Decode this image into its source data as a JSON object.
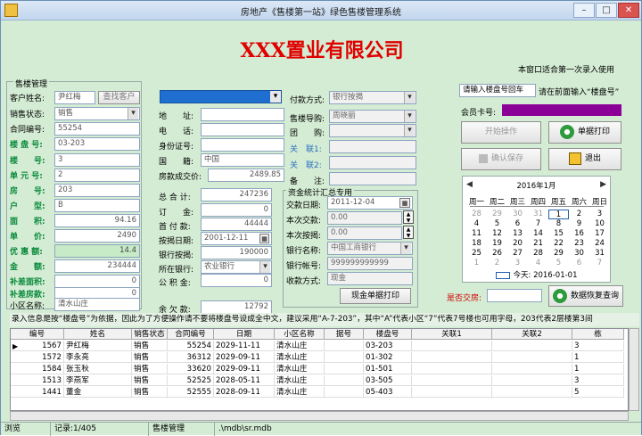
{
  "window": {
    "title": "房地产《售楼第一站》绿色售楼管理系统"
  },
  "header": {
    "company": "XXX置业有限公司",
    "note": "本窗口适合第一次录入使用"
  },
  "group": {
    "label": "售楼管理"
  },
  "left": {
    "cust_name_label": "客户姓名:",
    "cust_name": "尹红梅",
    "find_customer": "查找客户",
    "status_label": "销售状态:",
    "status": "销售",
    "contract_label": "合同编号:",
    "contract": "55254",
    "building_label": "楼 盘 号:",
    "building": "03-203",
    "tower_label": "楼　　号:",
    "tower": "3",
    "unit_label": "单 元 号:",
    "unit": "2",
    "room_label": "房　　号:",
    "room": "203",
    "type_label": "户　　型:",
    "type": "B",
    "area_label": "面　　积:",
    "area": "94.16",
    "price_label": "单　　价:",
    "price": "2490",
    "discount_label": "优 惠 额:",
    "discount": "14.4",
    "amount_label": "金　　额:",
    "amount": "234444",
    "extra_area_label": "补差面积:",
    "extra_area": "0",
    "extra_money_label": "补差房款:",
    "extra_money": "0",
    "estate_label": "小区名称:",
    "estate": "清水山庄"
  },
  "mid": {
    "address_label": "地　　址:",
    "phone_label": "电　　话:",
    "id_label": "身份证号:",
    "nation_label": "国　　籍:",
    "nation": "中国",
    "deal_price_label": "房款成交价:",
    "deal_price": "2489.85",
    "total_label": "总 合 计:",
    "total": "247236",
    "deposit_label": "订　　金:",
    "deposit": "0",
    "down_label": "首 付 款:",
    "down": "44444",
    "loan_date_label": "按揭日期:",
    "loan_date": "2001-12-11",
    "bank_loan_label": "银行按揭:",
    "bank_loan": "190000",
    "bank_label": "所在银行:",
    "bank": "农业银行",
    "fund_label": "公 积 金:",
    "fund": "0",
    "balance_label": "余 欠 款:",
    "balance": "12792"
  },
  "right": {
    "paymode_label": "付款方式:",
    "paymode": "银行按揭",
    "guide_label": "售楼导购:",
    "guide": "周晓丽",
    "group_buy_label": "团　　购:",
    "rel1_label": "关　联1:",
    "rel2_label": "关　联2:",
    "remark_label": "备　　注:"
  },
  "stats": {
    "label": "资金统计汇总专用",
    "date_label": "交款日期:",
    "date": "2011-12-04",
    "this_pay_label": "本次交款:",
    "this_pay": "0.00",
    "this_loan_label": "本次按揭:",
    "this_loan": "0.00",
    "bankname_label": "银行名称:",
    "bankname": "中国工商银行",
    "account_label": "银行帐号:",
    "account": "999999999999",
    "method_label": "收款方式:",
    "method": "现金",
    "print_btn": "现金单据打印"
  },
  "side": {
    "search_value": "请输入楼盘号回车",
    "search_hint": "请在前面输入“楼盘号”",
    "member_label": "会员卡号:",
    "start_btn": "开始操作",
    "print_btn": "单据打印",
    "save_btn": "确认保存",
    "exit_btn": "退出",
    "delivered_label": "是否交房:",
    "restore_btn": "数据恢复查询"
  },
  "calendar": {
    "month": "2016年1月",
    "weekdays": [
      "周一",
      "周二",
      "周三",
      "周四",
      "周五",
      "周六",
      "周日"
    ],
    "weeks": [
      [
        "28",
        "29",
        "30",
        "31",
        "1",
        "2",
        "3"
      ],
      [
        "4",
        "5",
        "6",
        "7",
        "8",
        "9",
        "10"
      ],
      [
        "11",
        "12",
        "13",
        "14",
        "15",
        "16",
        "17"
      ],
      [
        "18",
        "19",
        "20",
        "21",
        "22",
        "23",
        "24"
      ],
      [
        "25",
        "26",
        "27",
        "28",
        "29",
        "30",
        "31"
      ],
      [
        "1",
        "2",
        "3",
        "4",
        "5",
        "6",
        "7"
      ]
    ],
    "today": "今天: 2016-01-01"
  },
  "info": "录入信息是按“楼盘号”为依据，因此为了方便操作请不要将楼盘号设成全中文，建议采用“A-7-203”，其中“A”代表小区“7”代表7号楼也可用字母，203代表2层楼第3间",
  "table": {
    "headers": [
      "编号",
      "姓名",
      "销售状态",
      "合同编号",
      "日期",
      "小区名称",
      "据号",
      "楼盘号",
      "关联1",
      "关联2",
      "栋"
    ],
    "rows": [
      [
        "1567",
        "尹红梅",
        "销售",
        "55254",
        "2029-11-11",
        "清水山庄",
        "",
        "03-203",
        "",
        "",
        "3"
      ],
      [
        "1572",
        "李永亮",
        "销售",
        "36312",
        "2029-09-11",
        "清水山庄",
        "",
        "01-302",
        "",
        "",
        "1"
      ],
      [
        "1584",
        "张玉秋",
        "销售",
        "33620",
        "2029-09-11",
        "清水山庄",
        "",
        "01-501",
        "",
        "",
        "1"
      ],
      [
        "1513",
        "李燕军",
        "销售",
        "52525",
        "2028-05-11",
        "清水山庄",
        "",
        "03-505",
        "",
        "",
        "3"
      ],
      [
        "1441",
        "董金",
        "销售",
        "52555",
        "2028-09-11",
        "清水山庄",
        "",
        "05-403",
        "",
        "",
        "5"
      ]
    ]
  },
  "statusbar": {
    "mode": "浏览",
    "record": "记录:1/405",
    "module": "售楼管理",
    "path": ".\\mdb\\sr.mdb"
  },
  "colors": {
    "bg": "#d4ecd4",
    "title_red": "#e00000",
    "label_green": "#0a8a3c",
    "member_bar": "#8b0096",
    "select_blue": "#1f6fd1"
  }
}
